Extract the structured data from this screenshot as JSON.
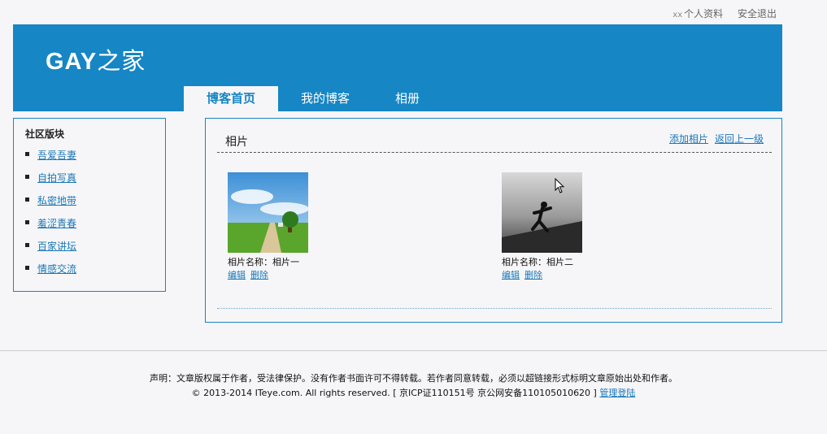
{
  "topbar": {
    "user": "xx",
    "profile": "个人资料",
    "logout": "安全退出"
  },
  "header": {
    "logo_latin": "GAY",
    "logo_cn": "之家"
  },
  "nav": {
    "tabs": [
      {
        "label": "博客首页"
      },
      {
        "label": "我的博客"
      },
      {
        "label": "相册"
      }
    ]
  },
  "sidebar": {
    "title": "社区版块",
    "items": [
      {
        "label": "吾爱吾妻"
      },
      {
        "label": "自拍写真"
      },
      {
        "label": "私密地带"
      },
      {
        "label": "羞涩青春"
      },
      {
        "label": "百家讲坛"
      },
      {
        "label": "情感交流"
      }
    ]
  },
  "main": {
    "title": "相片",
    "add_link": "添加相片",
    "back_link": "返回上一级",
    "photos": [
      {
        "name": "相片名称：相片一",
        "edit": "编辑",
        "delete": "删除"
      },
      {
        "name": "相片名称：相片二",
        "edit": "编辑",
        "delete": "删除"
      }
    ]
  },
  "footer": {
    "notice": "声明：文章版权属于作者，受法律保护。没有作者书面许可不得转载。若作者同意转载，必须以超链接形式标明文章原始出处和作者。",
    "copyright": "© 2013-2014 ITeye.com. All rights reserved. [ 京ICP证110151号 京公网安备110105010620 ]",
    "admin_link": "管理登陆"
  },
  "colors": {
    "brand": "#1686c4",
    "link": "#1a77b8"
  }
}
